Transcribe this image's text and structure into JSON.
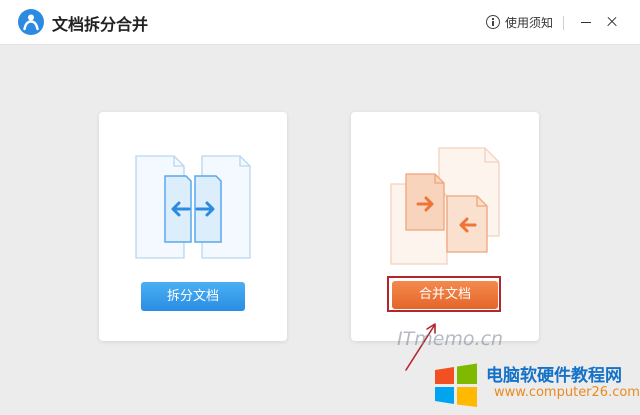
{
  "app": {
    "title": "文档拆分合并",
    "icon": "person-logo-icon",
    "accent": "#2c8ae0"
  },
  "titlebar": {
    "help_label": "使用须知",
    "help_icon": "info-circle-icon",
    "minimize_icon": "minimize-icon",
    "close_icon": "close-icon"
  },
  "cards": {
    "split": {
      "button_label": "拆分文档",
      "button_color": "#3a9cec",
      "illustration": "split-documents-icon"
    },
    "merge": {
      "button_label": "合并文档",
      "button_color": "#ee7438",
      "highlight_color": "#b3262a",
      "illustration": "merge-documents-icon"
    }
  },
  "watermark": {
    "text": "ITmemo.cn"
  },
  "site_badge": {
    "name": "电脑软硬件教程网",
    "url": "www.computer26.com",
    "logo": "windows-logo-icon"
  }
}
